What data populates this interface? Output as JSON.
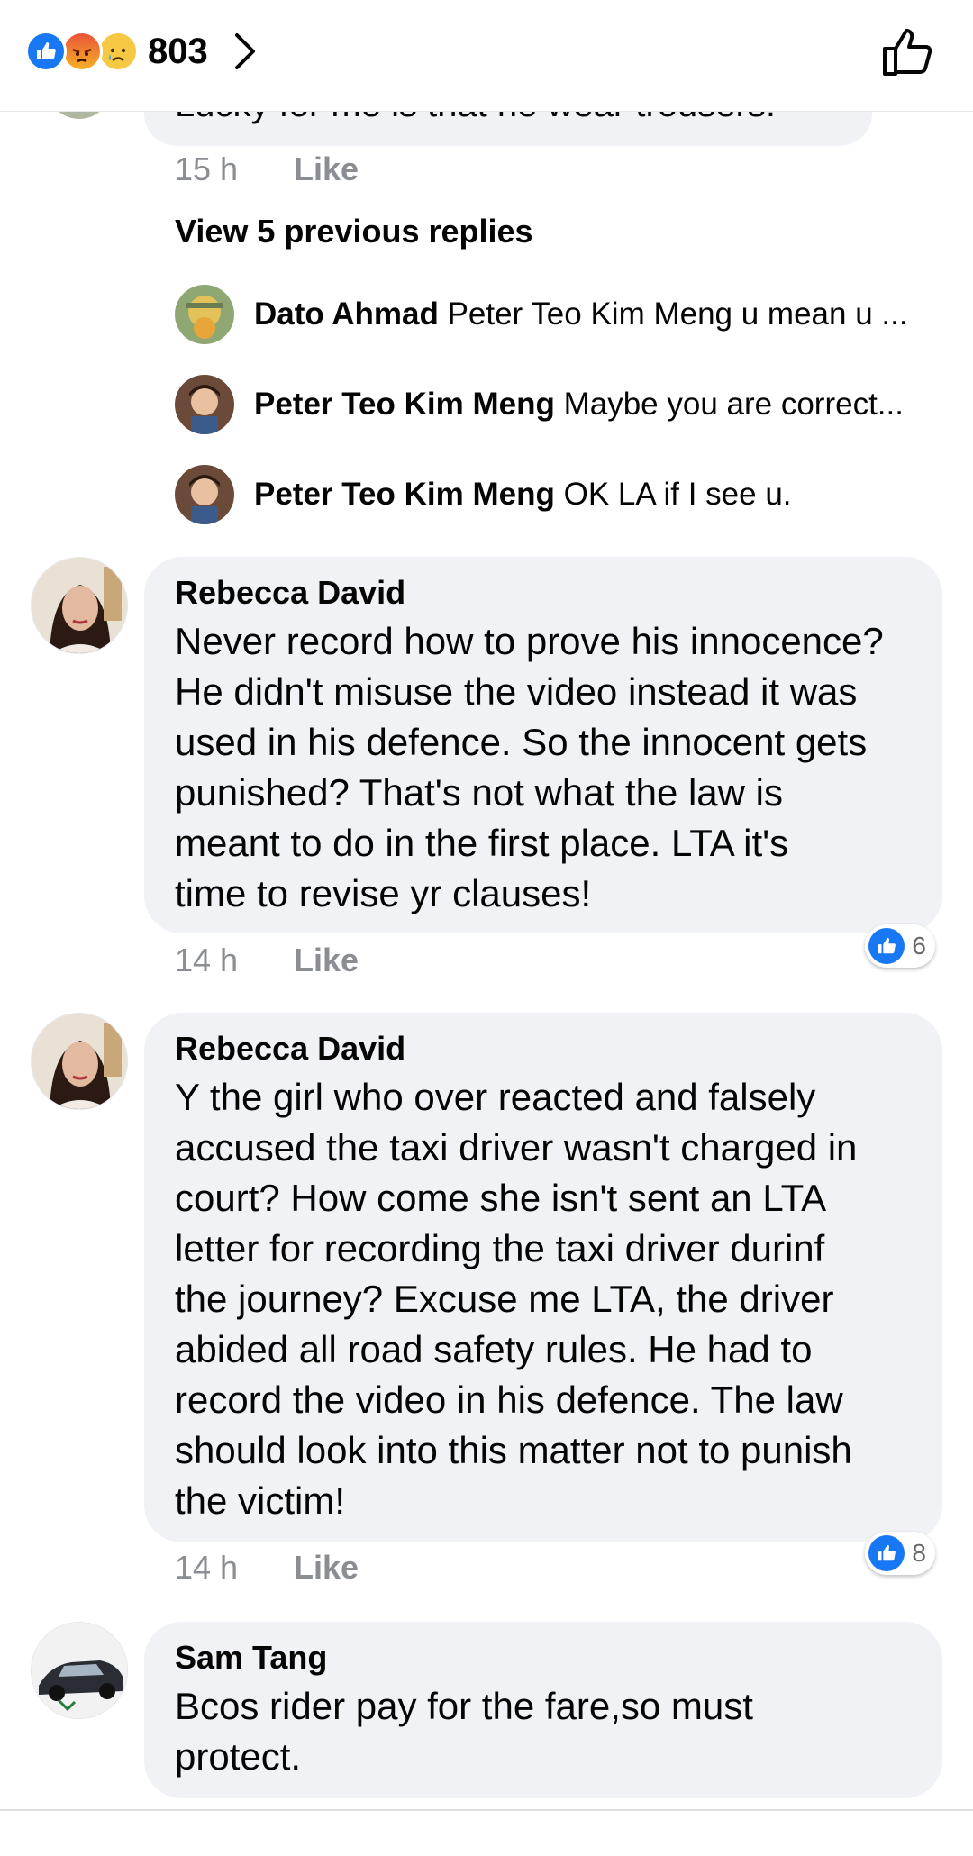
{
  "header": {
    "reaction_count": "803",
    "reactions": [
      "like-reaction-icon",
      "angry-reaction-icon",
      "sad-reaction-icon"
    ]
  },
  "truncated_comment": {
    "text": "Lucky for me is that he wear trousers.",
    "time": "15 h",
    "like_label": "Like"
  },
  "view_previous": "View 5 previous replies",
  "replies": [
    {
      "name": "Dato Ahmad",
      "text": "Peter Teo Kim Meng u mean u ..."
    },
    {
      "name": "Peter Teo Kim Meng",
      "text": "Maybe you are correct..."
    },
    {
      "name": "Peter Teo Kim Meng",
      "text": "OK LA if I see u."
    }
  ],
  "comments": [
    {
      "name": "Rebecca David",
      "text": "Never record how to prove his innocence?\nHe didn't misuse the video instead it was\nused in his defence. So the innocent gets\npunished? That's not what the law is\nmeant to do in the first place.  LTA it's\ntime to revise yr clauses!",
      "time": "14 h",
      "like_label": "Like",
      "likes": "6"
    },
    {
      "name": "Rebecca David",
      "text": "Y the girl who over reacted and falsely\naccused the taxi driver wasn't charged in\ncourt? How come she isn't sent an LTA\nletter for recording the taxi driver durinf\nthe journey? Excuse me LTA, the driver\nabided all road safety rules. He had to\nrecord the video in his defence. The law\nshould look into this matter not to punish\nthe victim!",
      "time": "14 h",
      "like_label": "Like",
      "likes": "8"
    },
    {
      "name": "Sam Tang",
      "text": "Bcos rider pay for the fare,so must\nprotect."
    }
  ],
  "colors": {
    "accent": "#1877f2",
    "bubble": "#f0f2f5",
    "meta_text": "#8a8d91"
  }
}
